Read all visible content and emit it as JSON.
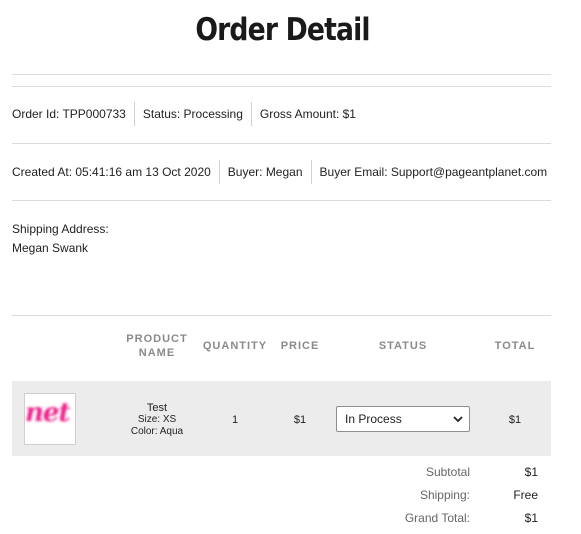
{
  "page": {
    "title": "Order Detail"
  },
  "order": {
    "order_id": "Order Id: TPP000733",
    "status": "Status: Processing",
    "gross_amount": "Gross Amount: $1",
    "created_at": "Created At: 05:41:16 am 13 Oct 2020",
    "buyer": "Buyer: Megan",
    "buyer_email": "Buyer Email: Support@pageantplanet.com"
  },
  "shipping": {
    "label": "Shipping Address:",
    "name": "Megan Swank"
  },
  "table": {
    "headers": {
      "product": "PRODUCT NAME",
      "quantity": "QUANTITY",
      "price": "PRICE",
      "status": "STATUS",
      "total": "TOTAL"
    },
    "items": [
      {
        "thumb_text": "net",
        "name": "Test",
        "size": "Size: XS",
        "color": "Color: Aqua",
        "quantity": "1",
        "price": "$1",
        "status": "In Process",
        "total": "$1"
      }
    ]
  },
  "summary": {
    "subtotal_label": "Subtotal",
    "subtotal": "$1",
    "shipping_label": "Shipping:",
    "shipping": "Free",
    "grand_label": "Grand Total:",
    "grand": "$1"
  },
  "colors": {
    "accent_pink": "#f0218a",
    "row_bg": "#ececec"
  }
}
